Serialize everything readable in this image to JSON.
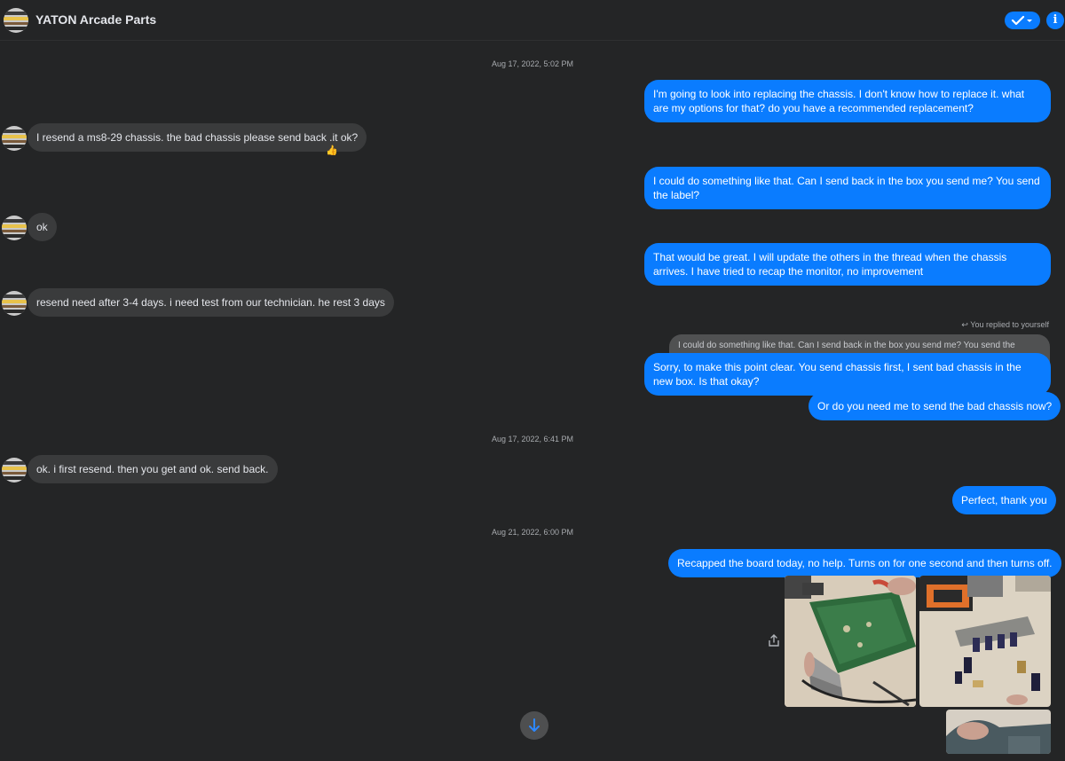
{
  "header": {
    "title": "YATON Arcade Parts",
    "check_icon": "check-dropdown-icon",
    "info_icon": "info-icon",
    "info_glyph": "i",
    "accent_color": "#0a7cff"
  },
  "timestamps": [
    "Aug 17, 2022, 5:02 PM",
    "Aug 17, 2022, 6:41 PM",
    "Aug 21, 2022, 6:00 PM"
  ],
  "messages": [
    {
      "dir": "out",
      "text": "I'm going to look into replacing the chassis. I don't know how to replace it. what are my options for that? do you have a recommended replacement?"
    },
    {
      "dir": "in",
      "text": "I resend a ms8-29 chassis. the bad chassis please send back .it ok?",
      "reaction": "👍"
    },
    {
      "dir": "out",
      "text": "I could do something like that. Can I send back in the box you send me? You send the label?"
    },
    {
      "dir": "in",
      "text": "ok"
    },
    {
      "dir": "out",
      "text": "That would be great. I will update the others in the thread when the chassis arrives. I have tried to recap the monitor, no improvement"
    },
    {
      "dir": "in",
      "text": "resend need after 3-4 days. i need test from our technician. he rest 3 days"
    },
    {
      "dir": "out",
      "text": "Sorry, to make this point clear. You send chassis first, I sent bad chassis in the new box. Is that okay?"
    },
    {
      "dir": "out",
      "text": "Or do you need me to send the bad chassis now?"
    },
    {
      "dir": "in",
      "text": "ok. i first resend. then you get and ok. send back."
    },
    {
      "dir": "out",
      "text": "Perfect, thank you"
    },
    {
      "dir": "out",
      "text": "Recapped the board today, no help. Turns on for one second and then turns off."
    }
  ],
  "reply": {
    "label": "You replied to yourself",
    "quoted_text": "I could do something like that. Can I send back in the box you send me? You send the label?"
  },
  "photos": [
    "photo-circuit-board",
    "photo-capacitors-desoldering",
    "photo-workbench"
  ],
  "share_icon": "share-icon",
  "scroll_icon": "arrow-down-icon"
}
